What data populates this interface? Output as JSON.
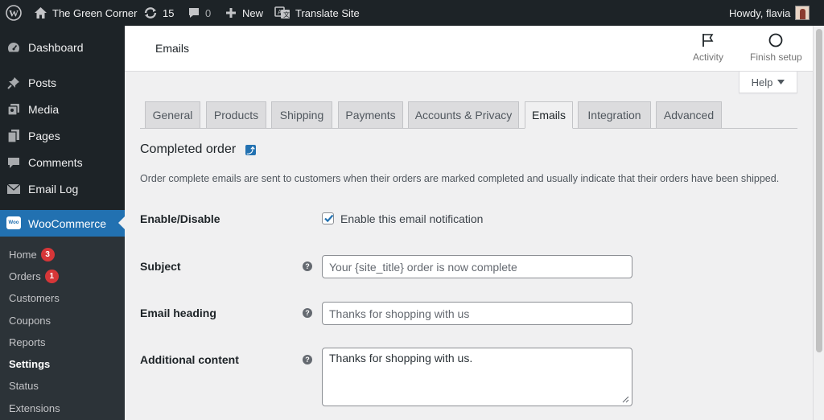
{
  "adminbar": {
    "site_name": "The Green Corner",
    "updates_count": "15",
    "comments_count": "0",
    "new_label": "New",
    "translate_label": "Translate Site",
    "greeting": "Howdy, flavia"
  },
  "sidebar": {
    "items": [
      {
        "label": "Dashboard",
        "icon": "dashboard-icon"
      },
      {
        "label": "Posts",
        "icon": "pin-icon"
      },
      {
        "label": "Media",
        "icon": "media-icon"
      },
      {
        "label": "Pages",
        "icon": "pages-icon"
      },
      {
        "label": "Comments",
        "icon": "comment-icon"
      },
      {
        "label": "Email Log",
        "icon": "email-icon"
      },
      {
        "label": "WooCommerce",
        "icon": "woocommerce-icon",
        "logo_text": "Woo"
      }
    ],
    "submenu": [
      {
        "label": "Home",
        "badge": "3"
      },
      {
        "label": "Orders",
        "badge": "1"
      },
      {
        "label": "Customers"
      },
      {
        "label": "Coupons"
      },
      {
        "label": "Reports"
      },
      {
        "label": "Settings"
      },
      {
        "label": "Status"
      },
      {
        "label": "Extensions"
      }
    ]
  },
  "header": {
    "title": "Emails",
    "activity_label": "Activity",
    "finish_setup_label": "Finish setup"
  },
  "help_label": "Help",
  "tabs": [
    "General",
    "Products",
    "Shipping",
    "Payments",
    "Accounts & Privacy",
    "Emails",
    "Integration",
    "Advanced"
  ],
  "active_tab": "Emails",
  "section": {
    "title": "Completed order",
    "description": "Order complete emails are sent to customers when their orders are marked completed and usually indicate that their orders have been shipped."
  },
  "form": {
    "enable_label": "Enable/Disable",
    "enable_checkbox_label": "Enable this email notification",
    "enable_checked": true,
    "subject_label": "Subject",
    "subject_placeholder": "Your {site_title} order is now complete",
    "subject_value": "",
    "heading_label": "Email heading",
    "heading_placeholder": "Thanks for shopping with us",
    "heading_value": "",
    "additional_label": "Additional content",
    "additional_value": "Thanks for shopping with us."
  },
  "colors": {
    "adminbar_bg": "#1d2327",
    "accent": "#2271b1",
    "badge": "#d63638"
  }
}
